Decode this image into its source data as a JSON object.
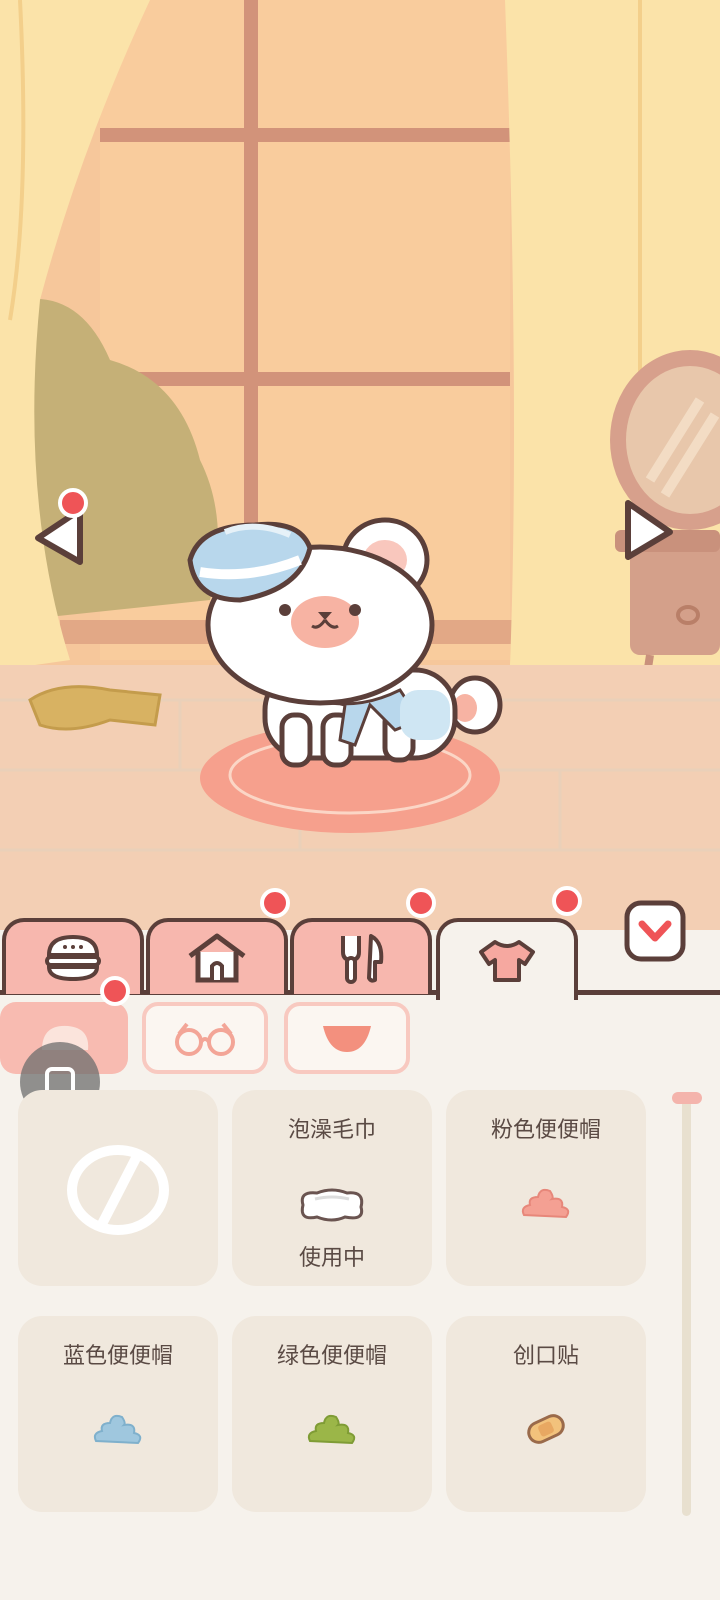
{
  "colors": {
    "wall": "#f6c79b",
    "curtain": "#fbe3a9",
    "floor": "#f3cfb4",
    "rug": "#f6a08d",
    "tab_inactive": "#f7b7ae",
    "tab_active": "#f6f2ec",
    "outline": "#5b3f3a",
    "badge": "#ef5457",
    "card_bg": "#f0e8dd",
    "panel_bg": "#f6f2ec"
  },
  "scene": {
    "pet": "white-bear-pet-with-sailor-hat",
    "left_arrow": "left-arrow-icon",
    "right_arrow": "right-arrow-icon"
  },
  "tabs": [
    {
      "icon": "burger-icon",
      "badge": false,
      "active": false
    },
    {
      "icon": "house-icon",
      "badge": true,
      "active": false
    },
    {
      "icon": "fork-knife-icon",
      "badge": true,
      "active": false
    },
    {
      "icon": "shirt-icon",
      "badge": true,
      "active": true
    }
  ],
  "collapse_icon": "chevron-down-icon",
  "subtabs": [
    {
      "icon": "hat-icon",
      "active": true,
      "badge": true
    },
    {
      "icon": "glasses-icon",
      "active": false,
      "badge": false
    },
    {
      "icon": "bib-icon",
      "active": false,
      "badge": false
    }
  ],
  "items": [
    {
      "name": "",
      "status": "",
      "icon": "none-icon"
    },
    {
      "name": "泡澡毛巾",
      "status": "使用中",
      "icon": "towel-icon"
    },
    {
      "name": "粉色便便帽",
      "status": "",
      "icon": "pink-poop-hat-icon"
    },
    {
      "name": "蓝色便便帽",
      "status": "",
      "icon": "blue-poop-hat-icon"
    },
    {
      "name": "绿色便便帽",
      "status": "",
      "icon": "green-poop-hat-icon"
    },
    {
      "name": "创口贴",
      "status": "",
      "icon": "bandage-icon"
    }
  ],
  "float_button_icon": "square-icon"
}
